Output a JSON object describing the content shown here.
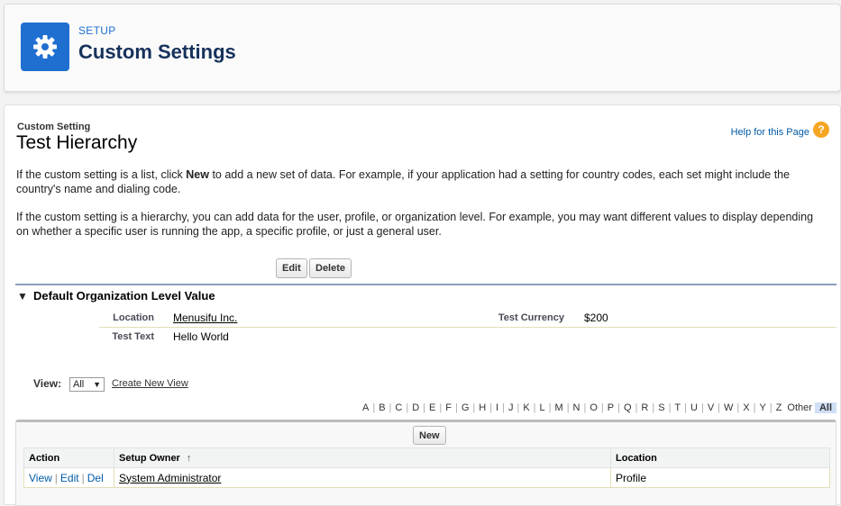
{
  "header": {
    "eyebrow": "SETUP",
    "title": "Custom Settings",
    "icon": "gear-icon",
    "accent_color": "#1f6fd1"
  },
  "page": {
    "eyebrow": "Custom Setting",
    "title": "Test Hierarchy",
    "help_link": "Help for this Page",
    "help_icon": "?",
    "para1_part1": "If the custom setting is a list, click ",
    "para1_bold": "New",
    "para1_part2": " to add a new set of data. For example, if your application had a setting for country codes, each set might include the country's name and dialing code.",
    "para2": "If the custom setting is a hierarchy, you can add data for the user, profile, or organization level. For example, you may want different values to display depending on whether a specific user is running the app, a specific profile, or just a general user."
  },
  "buttons": {
    "edit": "Edit",
    "delete": "Delete",
    "new": "New"
  },
  "section": {
    "toggle": "▼",
    "title": "Default Organization Level Value",
    "fields": {
      "location_label": "Location",
      "location_value": "Menusifu Inc.",
      "currency_label": "Test Currency",
      "currency_value": "$200",
      "text_label": "Test Text",
      "text_value": "Hello World"
    }
  },
  "view": {
    "label": "View:",
    "selected": "All",
    "arrow": "▼",
    "create_link": "Create New View"
  },
  "alphabet": [
    "A",
    "B",
    "C",
    "D",
    "E",
    "F",
    "G",
    "H",
    "I",
    "J",
    "K",
    "L",
    "M",
    "N",
    "O",
    "P",
    "Q",
    "R",
    "S",
    "T",
    "U",
    "V",
    "W",
    "X",
    "Y",
    "Z",
    "Other"
  ],
  "alphabet_selected": "All",
  "table": {
    "headers": {
      "action": "Action",
      "owner": "Setup Owner",
      "sort_arrow": "↑",
      "location": "Location"
    },
    "rows": [
      {
        "actions": [
          "View",
          "Edit",
          "Del"
        ],
        "owner": "System Administrator",
        "location": "Profile"
      }
    ]
  }
}
